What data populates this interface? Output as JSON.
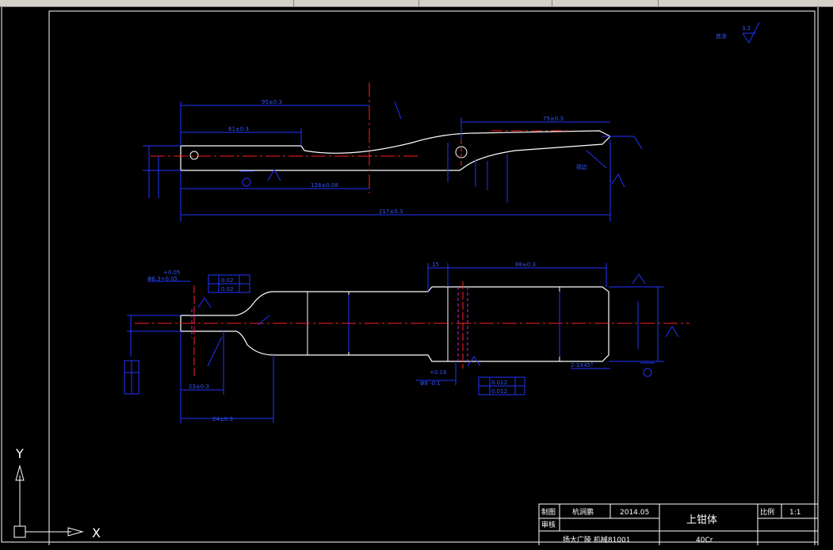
{
  "colors": {
    "background": "#000000",
    "part_outline": "#ffffff",
    "dimension": "#1f2bff",
    "centerline": "#ff2020",
    "hidden": "#d020d0",
    "frame": "#ffffff"
  },
  "roughness": {
    "prefix": "其余",
    "value": "3.2"
  },
  "top_view_dims": {
    "overall": "217±0.3",
    "len_95": "95±0.3",
    "len_61": "61±0.3",
    "len_128": "128±0.08",
    "len_75": "75±0.3",
    "note_right": "锐边"
  },
  "bottom_view_dims": {
    "len_24": "24±0.3",
    "len_23": "23±0.3",
    "len_88": "88±0.3",
    "len_15": "15",
    "tol_upper": "+0.05",
    "hole_dia": "Φ6.3+0.05",
    "bore": "Φ8 -0.1",
    "chamfer": "2-1X45°",
    "tol_01": "+0.16",
    "geo_tol_1a": "0.02",
    "geo_tol_1b": "0.02",
    "geo_tol_2a": "0.012",
    "geo_tol_2b": "0.012"
  },
  "ucs": {
    "x_label": "X",
    "y_label": "Y"
  },
  "title_block": {
    "row1_label": "制图",
    "row1_name": "杭涧鹏",
    "row1_date": "2014.05",
    "row2_label": "审核",
    "school": "扬大广陵 机械81001",
    "part_name": "上钳体",
    "scale_label": "比例",
    "scale_value": "1:1",
    "material": "40Cr"
  }
}
